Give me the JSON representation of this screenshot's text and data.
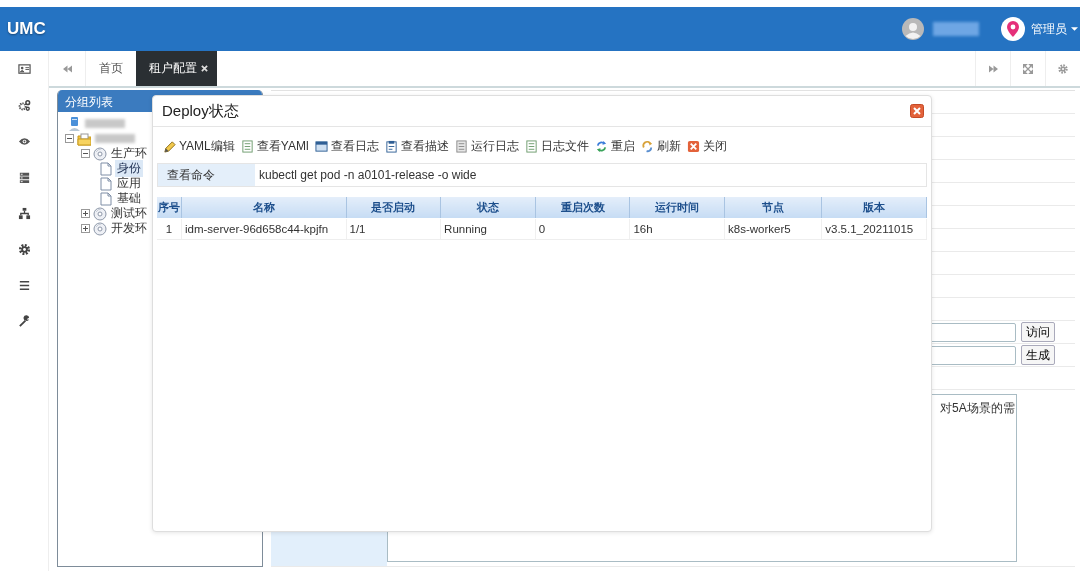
{
  "header": {
    "logo": "UMC",
    "user_menu": {
      "label": "管理员"
    }
  },
  "tabs": [
    {
      "label": "首页",
      "selected": false,
      "closable": false
    },
    {
      "label": "租户配置",
      "selected": true,
      "closable": true
    }
  ],
  "group_panel": {
    "title": "分组列表",
    "tree": [
      {
        "kind": "server"
      },
      {
        "kind": "folder",
        "expanded": true,
        "children": [
          {
            "kind": "env",
            "label": "生产环",
            "expanded": true,
            "children": [
              {
                "kind": "page",
                "label": "身份",
                "selected": true
              },
              {
                "kind": "page",
                "label": "应用",
                "selected": false
              },
              {
                "kind": "page",
                "label": "基础",
                "selected": false
              }
            ]
          },
          {
            "kind": "env",
            "label": "测试环",
            "expanded": false
          },
          {
            "kind": "env",
            "label": "开发环",
            "expanded": false
          }
        ]
      }
    ]
  },
  "form": {
    "buttons": [
      "访问",
      "生成"
    ],
    "description": "对5A场景的需"
  },
  "dialog": {
    "title": "Deploy状态",
    "toolbar": [
      "YAML编辑",
      "查看YAMl",
      "查看日志",
      "查看描述",
      "运行日志",
      "日志文件",
      "重启",
      "刷新",
      "关闭"
    ],
    "command": {
      "label": "查看命令",
      "value": "kubectl get pod -n a0101-release -o wide"
    },
    "table": {
      "columns": [
        "序号",
        "名称",
        "是否启动",
        "状态",
        "重启次数",
        "运行时间",
        "节点",
        "版本"
      ],
      "rows": [
        [
          "1",
          "idm-server-96d658c44-kpjfn",
          "1/1",
          "Running",
          "0",
          "16h",
          "k8s-worker5",
          "v3.5.1_20211015"
        ]
      ]
    }
  }
}
